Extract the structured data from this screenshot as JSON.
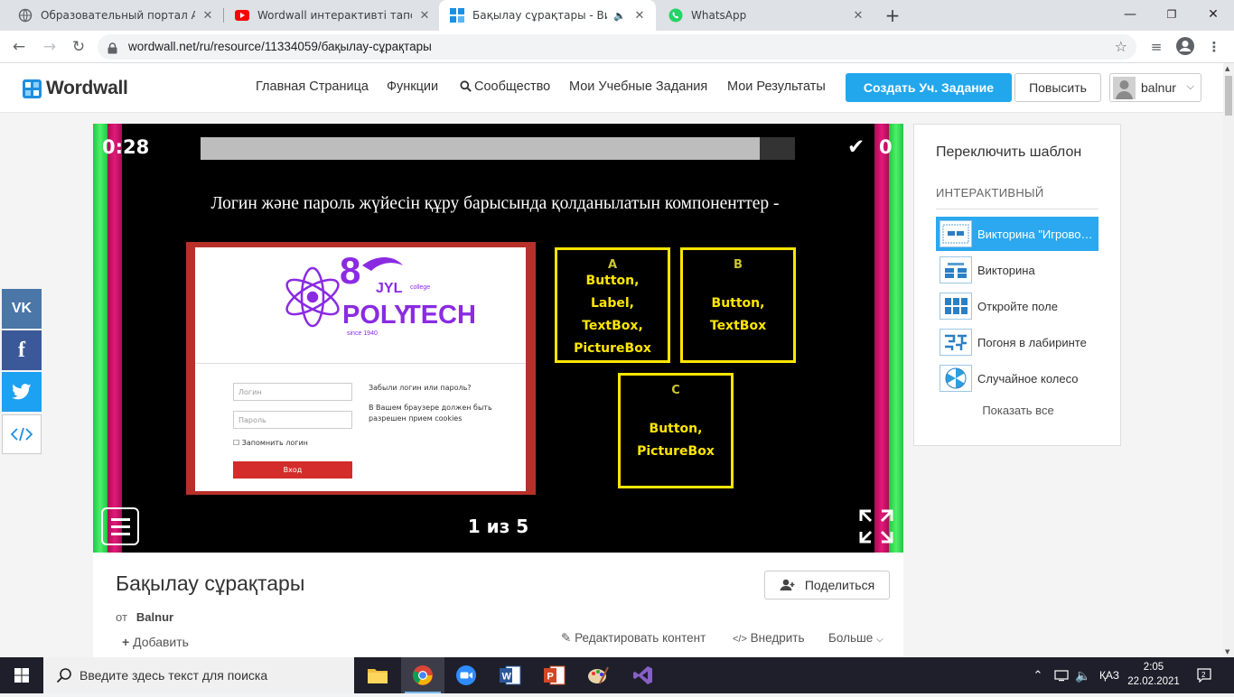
{
  "browser": {
    "tabs": [
      {
        "title": "Образовательный портал Алматы"
      },
      {
        "title": "Wordwall интерактивті тапсырмалар"
      },
      {
        "title": "Бақылау сұрақтары - Викторина"
      },
      {
        "title": "WhatsApp"
      }
    ],
    "url": "wordwall.net/ru/resource/11334059/бақылау-сұрақтары"
  },
  "site": {
    "logo": "Wordwall",
    "nav": [
      "Главная Страница",
      "Функции",
      "Сообщество",
      "Мои Учебные Задания",
      "Мои Результаты"
    ],
    "create_label": "Создать Уч. Задание",
    "upgrade_label": "Повысить",
    "user_name": "balnur"
  },
  "share_buttons": [
    "VK",
    "f"
  ],
  "game": {
    "timer": "0:28",
    "progress": 0.94,
    "score": "0",
    "question": "Логин және пароль жүйесін құру барысында қолданылатын компоненттер -",
    "pager": "1 из 5",
    "image": {
      "college": "college",
      "jyl": "JYL",
      "since": "since 1940",
      "forgot": "Забыли логин или пароль?",
      "cookies": "В Вашем браузере должен быть разрешен прием cookies",
      "login_ph": "Логин",
      "password_ph": "Пароль",
      "remember": "Запомнить логин",
      "enter": "Вход"
    },
    "answers": [
      {
        "letter": "A",
        "text": "Button, Label, TextBox, PictureBox"
      },
      {
        "letter": "B",
        "text": "Button, TextBox"
      },
      {
        "letter": "C",
        "text": "Button, PictureBox"
      }
    ]
  },
  "templates": {
    "heading": "Переключить шаблон",
    "section": "ИНТЕРАКТИВНЫЙ",
    "items": [
      {
        "name": "Викторина \"Игровое шоу\""
      },
      {
        "name": "Викторина"
      },
      {
        "name": "Откройте поле"
      },
      {
        "name": "Погоня в лабиринте"
      },
      {
        "name": "Случайное колесо"
      }
    ],
    "show_all": "Показать все"
  },
  "info": {
    "title": "Бақылау сұрақтары",
    "share_label": "Поделиться",
    "by_prefix": "от",
    "author": "Balnur",
    "add_label": "Добавить",
    "edit_label": "Редактировать контент",
    "embed_label": "Внедрить",
    "more_label": "Больше"
  },
  "taskbar": {
    "search_placeholder": "Введите здесь текст для поиска",
    "lang": "ҚАЗ",
    "time": "2:05",
    "date": "22.02.2021"
  },
  "colors": {
    "accent": "#23a7ec",
    "answer_border": "#ffe600",
    "stripe_green": "#2fd14f",
    "stripe_magenta": "#d4106a"
  }
}
